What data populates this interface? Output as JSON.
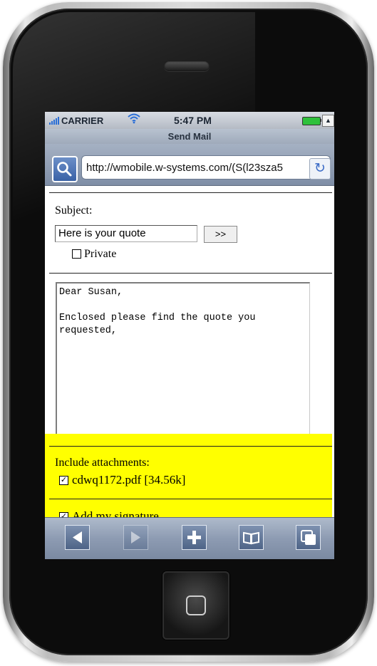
{
  "status_bar": {
    "carrier": "CARRIER",
    "time": "5:47 PM"
  },
  "browser": {
    "page_title": "Send Mail",
    "url": "http://wmobile.w-systems.com/(S(l23sza5"
  },
  "form": {
    "subject_label": "Subject:",
    "subject_value": "Here is your quote",
    "go_button_label": ">>",
    "private_label": "Private",
    "private_checked": false,
    "body_text": "Dear Susan,\n\nEnclosed please find the quote you\nrequested,",
    "attachments_label": "Include attachments:",
    "attachment_file": "cdwq1172.pdf [34.56k]",
    "attachment_checked": true,
    "signature_label": "Add my signature",
    "signature_checked": true,
    "highlight_color": "#ffff00"
  },
  "toolbar": {
    "items": [
      "back-icon",
      "forward-icon",
      "add-bookmark-icon",
      "bookmarks-icon",
      "pages-icon"
    ]
  }
}
